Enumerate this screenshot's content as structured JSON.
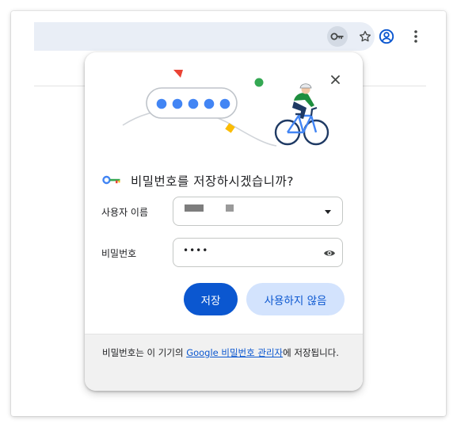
{
  "browser": {
    "toolbar_icons": [
      "password-key-icon",
      "star-icon",
      "profile-icon",
      "more-vert-icon"
    ]
  },
  "dialog": {
    "title": "비밀번호를 저장하시겠습니까?",
    "username_label": "사용자 이름",
    "password_label": "비밀번호",
    "password_masked": "••••",
    "save_button": "저장",
    "never_button": "사용하지 않음",
    "footer_prefix": "비밀번호는 이 기기의 ",
    "footer_link": "Google 비밀번호 관리자",
    "footer_suffix": "에 저장됩니다."
  },
  "colors": {
    "accent": "#0b57d0",
    "secondary_button_bg": "#d3e3fd",
    "footer_bg": "#f1f1f1",
    "omnibox_bg": "#e9eef6"
  }
}
